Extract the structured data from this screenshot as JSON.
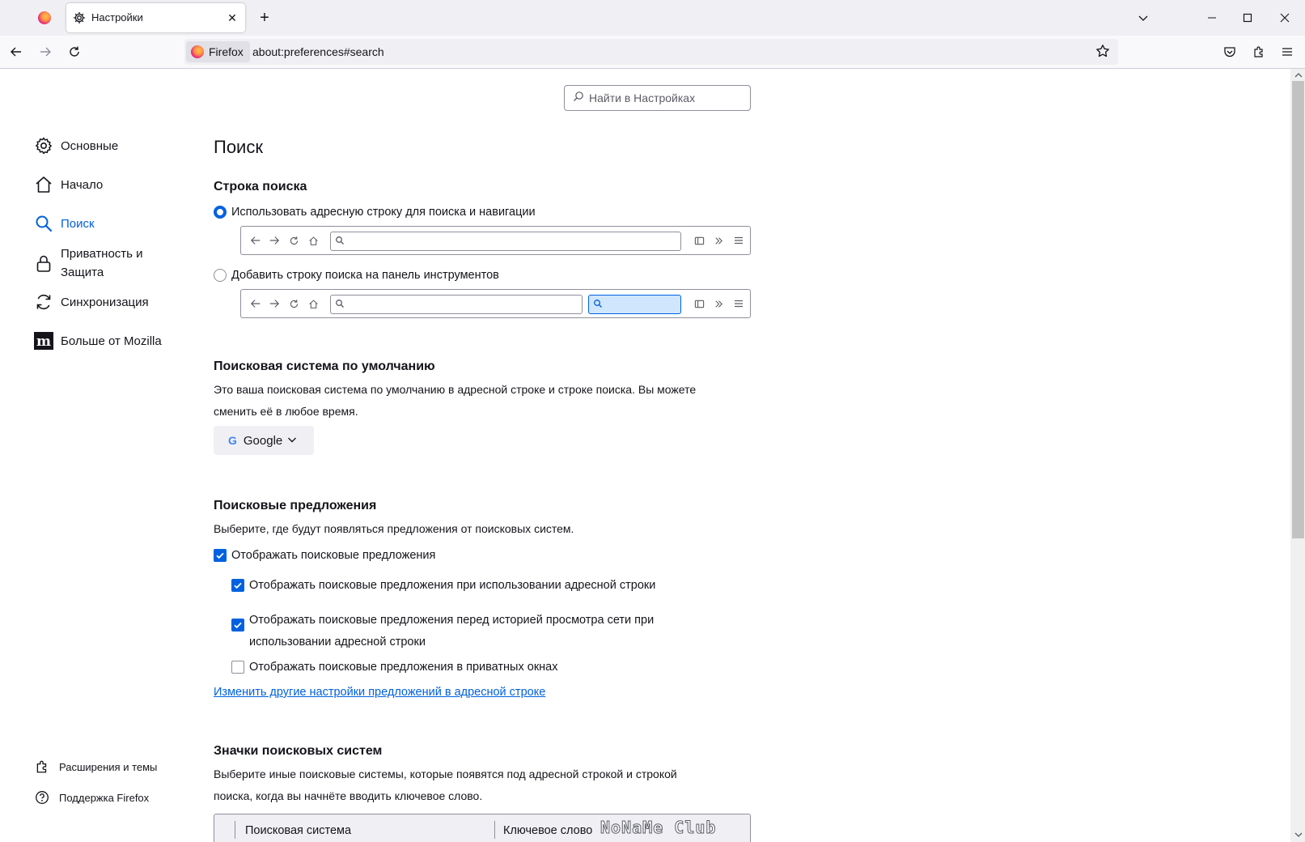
{
  "tabs": {
    "active_title": "Настройки"
  },
  "navbar": {
    "identity_label": "Firefox",
    "url": "about:preferences#search"
  },
  "settings_search": {
    "placeholder": "Найти в Настройках"
  },
  "sidebar": {
    "items": [
      {
        "label": "Основные",
        "icon": "gear-icon"
      },
      {
        "label": "Начало",
        "icon": "home-icon"
      },
      {
        "label": "Поиск",
        "icon": "search-icon",
        "selected": true
      },
      {
        "label": "Приватность и Защита",
        "icon": "lock-icon"
      },
      {
        "label": "Синхронизация",
        "icon": "sync-icon"
      },
      {
        "label": "Больше от Mozilla",
        "icon": "mozilla-icon"
      }
    ],
    "footer": [
      {
        "label": "Расширения и темы",
        "icon": "extension-icon"
      },
      {
        "label": "Поддержка Firefox",
        "icon": "help-icon"
      }
    ]
  },
  "main": {
    "page_title": "Поиск",
    "searchbar": {
      "heading": "Строка поиска",
      "option_urlbar": "Использовать адресную строку для поиска и навигации",
      "option_urlbar_checked": true,
      "option_toolbar": "Добавить строку поиска на панель инструментов",
      "option_toolbar_checked": false
    },
    "default_engine": {
      "heading": "Поисковая система по умолчанию",
      "description_line1": "Это ваша поисковая система по умолчанию в адресной строке и строке поиска. Вы можете",
      "description_line2": "сменить её в любое время.",
      "selected_engine": "Google"
    },
    "suggestions": {
      "heading": "Поисковые предложения",
      "description": "Выберите, где будут появляться предложения от поисковых систем.",
      "show_suggestions": "Отображать поисковые предложения",
      "show_suggestions_checked": true,
      "in_urlbar": "Отображать поисковые предложения при использовании адресной строки",
      "in_urlbar_checked": true,
      "before_history_line1": "Отображать поисковые предложения перед историей просмотра сети при",
      "before_history_line2": "использовании адресной строки",
      "before_history_checked": true,
      "in_private": "Отображать поисковые предложения в приватных окнах",
      "in_private_checked": false,
      "link": "Изменить другие настройки предложений в адресной строке"
    },
    "shortcuts": {
      "heading": "Значки поисковых систем",
      "description_line1": "Выберите иные поисковые системы, которые появятся под адресной строкой и строкой",
      "description_line2": "поиска, когда вы начнёте вводить ключевое слово.",
      "col_engine": "Поисковая система",
      "col_keyword": "Ключевое слово"
    }
  },
  "watermark": "NoNaMe Club",
  "colors": {
    "accent": "#0061e0",
    "tabbar_bg": "#f0f0f4",
    "text": "#15141a"
  }
}
